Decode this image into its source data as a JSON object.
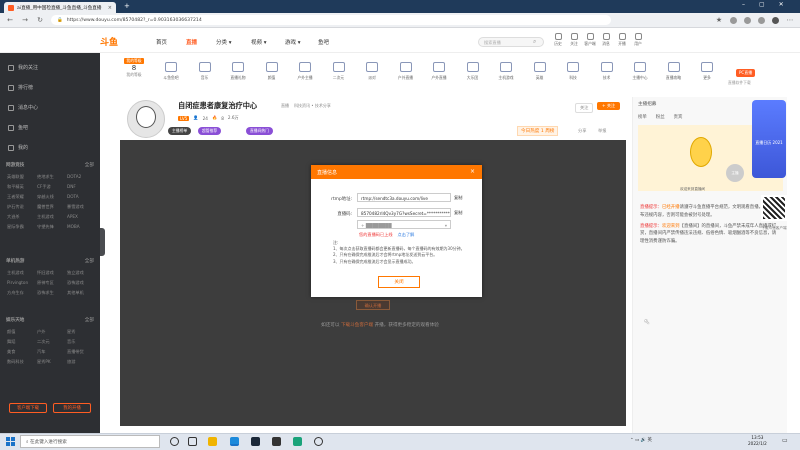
{
  "browser": {
    "tab_title": "ai直播_用中国检直播_斗鱼直播_斗鱼直播",
    "new_tab": "+",
    "url": "https://www.douyu.com/8570482?_r=0.903163036637214"
  },
  "site": {
    "logo": "斗鱼",
    "nav": [
      "首页",
      "直播",
      "分类 ▾",
      "视频 ▾",
      "游戏 ▾",
      "鱼吧"
    ],
    "search_placeholder": "搜索直播",
    "header_icons": [
      {
        "icon": "history-icon",
        "label": "历史"
      },
      {
        "icon": "follow-icon",
        "label": "关注"
      },
      {
        "icon": "download-icon",
        "label": "客户端"
      },
      {
        "icon": "message-icon",
        "label": "消息"
      },
      {
        "icon": "broadcast-icon",
        "label": "开播"
      },
      {
        "icon": "user-icon",
        "label": "用户"
      }
    ]
  },
  "sidebar": {
    "top_items": [
      "我的关注",
      "排行榜",
      "消息中心",
      "鱼吧",
      "我的"
    ],
    "sections": [
      {
        "title": "网游竞技",
        "more": "全部",
        "links": [
          "英雄联盟",
          "绝地求生",
          "DOTA2",
          "和平精英",
          "CF手游",
          "DNF",
          "王者荣耀",
          "穿越火线",
          "DOTA",
          "炉石传说",
          "魔兽世界",
          "暴雪游戏",
          "大逃杀",
          "主机游戏",
          "APEX",
          "星际争霸",
          "守望先锋",
          "MOBA"
        ]
      },
      {
        "title": "单机热游",
        "more": "全部",
        "links": [
          "主机游戏",
          "怀旧游戏",
          "独立游戏",
          "Pirvington",
          "原神专区",
          "恐怖游戏",
          "方舟生存",
          "恐怖求生",
          "其他单机"
        ]
      },
      {
        "title": "娱乐天地",
        "more": "全部",
        "links": [
          "颜值",
          "户外",
          "星秀",
          "舞蹈",
          "二次元",
          "音乐",
          "美食",
          "汽车",
          "直播带货",
          "数码科技",
          "星秀PK",
          "旅游"
        ]
      }
    ],
    "buttons": [
      "客户端下载",
      "我的开播"
    ]
  },
  "categories": {
    "level": {
      "badge": "我的等级",
      "num": "8",
      "label": "我的等级"
    },
    "items": [
      "斗鱼鱼吧",
      "音乐",
      "直播礼物",
      "颜值",
      "户外主播",
      "二次元",
      "派对",
      "户外直播",
      "户外直播",
      "大乐团",
      "主机游戏",
      "英雄",
      "科技",
      "技术",
      "主播中心",
      "直播攻略",
      "更多"
    ],
    "pc_badge": "PC直播",
    "pc_sub": "直播软件下载"
  },
  "room": {
    "title": "自闭症患者康复治疗中心",
    "meta": [
      "直播",
      "科技资讯 • 技术分享"
    ],
    "level": "LV5",
    "watchers": "24",
    "hot": "8",
    "views": "2.6万",
    "rank_pill": "主播榜单",
    "purple_tags": [
      "超管推荐",
      "直播间热门"
    ],
    "today_rank": "今日热度 1 周榜",
    "share": "分享",
    "report": "举报",
    "btn_report": "关注",
    "btn_follow": "+ 关注"
  },
  "player": {
    "ghost_button": "确认开播",
    "message_pre": "如还可以 ",
    "message_hl": "下载斗鱼客户端",
    "message_post": " 开播，获得更多稳定的观看体验"
  },
  "modal": {
    "title": "直播信息",
    "close": "×",
    "rtmp_label": "rtmp地址:",
    "rtmp_value": "rtmp://sendtc3a.douyu.com/live",
    "copy1": "复制",
    "code_label": "直播码:",
    "code_value": "8570482rI4Qv3y7G?wsSecret=************",
    "copy2": "复制",
    "select_value": "+ ████████",
    "tip": "您的直播码已上线",
    "tip_link": "点击了解",
    "notes_title": "注:",
    "notes": [
      "1、每次点击获取直播码都会更新直播码，每个直播码的有效期为30分钟。",
      "2、只有在确保完成推流后才会将rtmp地址发送到云平台。",
      "3、只有在确保完成推流后才会显示直播成功。"
    ],
    "close_button": "关闭"
  },
  "right_panel": {
    "header": "主播招募",
    "tabs": [
      "榜单",
      "粉丝",
      "贵宾"
    ],
    "welcome": "欢迎来到直播间",
    "user_badge": "主播",
    "news": [
      {
        "pre": "直播提示：",
        "o": "已经开播",
        "rest": "请遵守斗鱼直播平台规范，文明观看直播，禁止发布违规内容，否则可能会被封号处理。"
      },
      {
        "pre": "直播提示：",
        "o": "欢迎来到",
        "rest": "【直播间】的直播间，斗鱼严禁未成年人直播或打赏，直播间内严禁传播违法违规、低俗色情、吸烟酗酒等不良信息，请理性消费谨防诈骗。"
      }
    ],
    "float_title": "直播日历 2021",
    "qr_label": "下载斗鱼客户端"
  },
  "taskbar": {
    "search": "在此键入进行搜索",
    "time": "13:53",
    "date": "2022/1/2"
  }
}
